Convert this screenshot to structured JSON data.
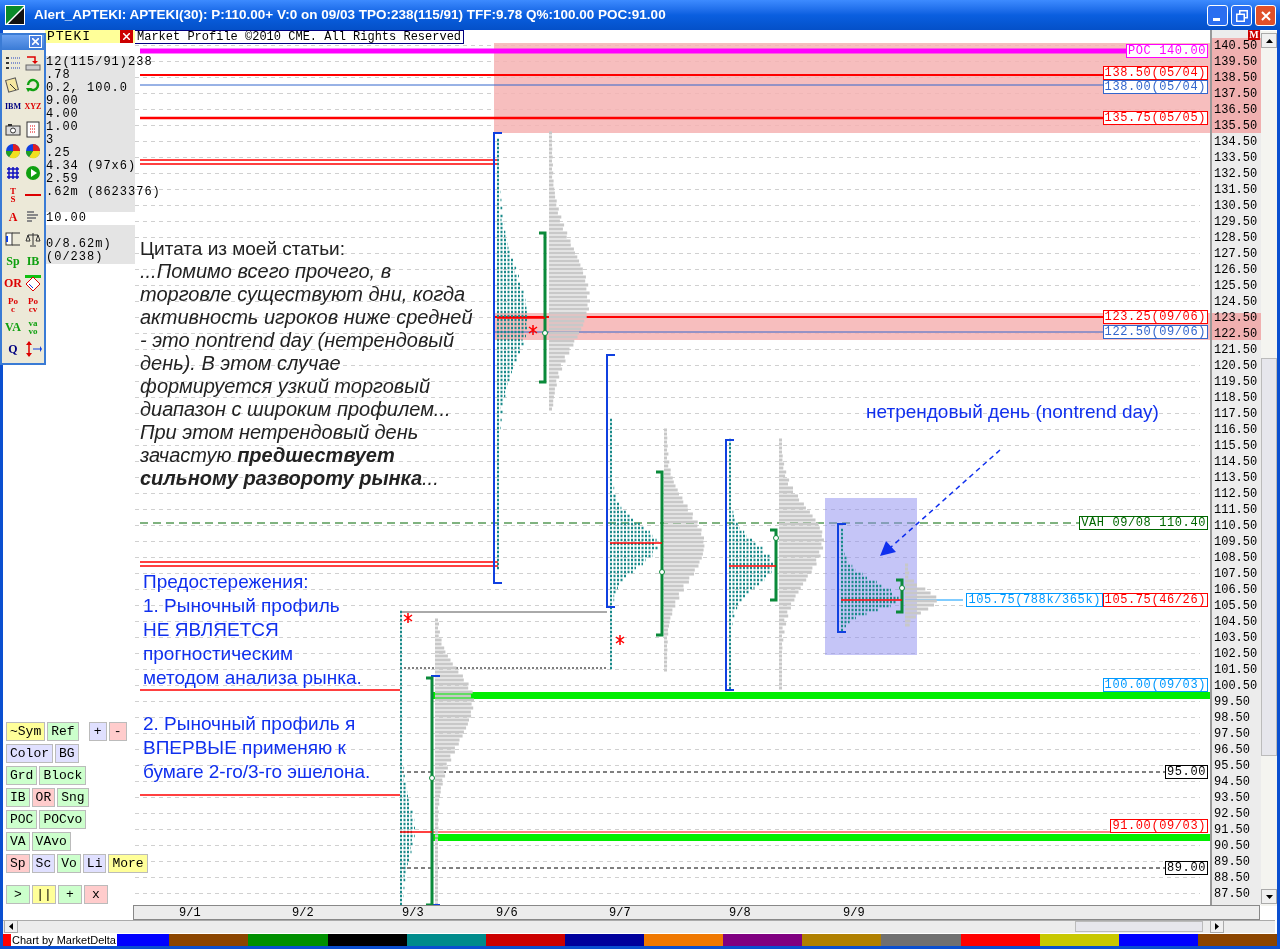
{
  "window": {
    "title": "Alert_APTEKI: APTEKI(30): P:110.00+ V:0 on 09/03 TPO:238(115/91) TFF:9.78 Q%:100.00 POC:91.00"
  },
  "toolbar": {
    "letter_icons": [
      {
        "lines": [
          "IBM"
        ]
      },
      {
        "lines": [
          "XYZ"
        ]
      },
      {
        "lines": [
          "T",
          "S"
        ]
      },
      {
        "lines": [
          "A"
        ]
      },
      {
        "lines": [
          "Sp"
        ]
      },
      {
        "lines": [
          "IB"
        ]
      },
      {
        "lines": [
          "OR"
        ]
      },
      {
        "lines": [
          "Po",
          "c"
        ]
      },
      {
        "lines": [
          "Po",
          "cv"
        ]
      },
      {
        "lines": [
          "VA"
        ]
      },
      {
        "lines": [
          "va",
          "vo"
        ]
      },
      {
        "lines": [
          "Q"
        ]
      }
    ]
  },
  "info_panel": {
    "symbol": "PTEKI",
    "rows": [
      "",
      "12(115/91)238",
      ".78",
      "0.2, 100.0",
      "9.00",
      "4.00",
      "1.00",
      "3",
      ".25",
      "4.34 (97x6)",
      "2.59",
      ".62m (8623376)",
      "",
      "10.00",
      "",
      "0/8.62m)",
      " (0/238)"
    ]
  },
  "chart": {
    "copyright": "Market Profile ©2010 CME. All Rights Reserved",
    "m_button": "M",
    "levels": [
      {
        "text": "POC 140.00",
        "color": "#ff00ff"
      },
      {
        "text": "138.50(05/04)",
        "color": "#ff0000"
      },
      {
        "text": "138.00(05/04)",
        "color": "#3366cc"
      },
      {
        "text": "135.75(05/05)",
        "color": "#ff0000"
      },
      {
        "text": "123.25(09/06)",
        "color": "#ff0000"
      },
      {
        "text": "122.50(09/06)",
        "color": "#3366cc"
      },
      {
        "text": "VAH 09/08 110.40",
        "color": "#006600"
      },
      {
        "text": "105.75(788k/365k)",
        "color": "#0099ff"
      },
      {
        "text": "105.75(46/26)",
        "color": "#ff0000"
      },
      {
        "text": "100.00(09/03)",
        "color": "#0099ff"
      },
      {
        "text": "95.00",
        "color": "#000000"
      },
      {
        "text": "91.00(09/03)",
        "color": "#ff0000"
      },
      {
        "text": "89.00",
        "color": "#000000"
      }
    ],
    "quote_heading": "Цитата из моей статьи:",
    "quote": "...Помимо всего прочего, в торговле существуют дни, когда активность игроков ниже средней - это nontrend day (нетрендовый день). В этом случае формируется узкий торговый диапазон с широким профилем... При этом нетрендовый день зачастую **предшествует сильному развороту рынка**...",
    "nontrend_note": "нетрендовый день (nontrend day)",
    "warnings": [
      "Предостережения:",
      "1. Рыночный профиль НЕ ЯВЛЯЕТСЯ прогностическим методом анализа рынка.",
      "2. Рыночный профиль я ВПЕРВЫЕ применяю к бумаге 2-го/3-го эшелона."
    ],
    "price_axis": [
      "140.50",
      "139.50",
      "138.50",
      "137.50",
      "136.50",
      "135.50",
      "134.50",
      "133.50",
      "132.50",
      "131.50",
      "130.50",
      "129.50",
      "128.50",
      "127.50",
      "126.50",
      "125.50",
      "124.50",
      "123.50",
      "122.50",
      "121.50",
      "120.50",
      "119.50",
      "118.50",
      "117.50",
      "116.50",
      "115.50",
      "114.50",
      "113.50",
      "112.50",
      "111.50",
      "110.50",
      "109.50",
      "108.50",
      "107.50",
      "106.50",
      "105.50",
      "104.50",
      "103.50",
      "102.50",
      "101.50",
      "100.50",
      "99.50",
      "98.50",
      "97.50",
      "96.50",
      "95.50",
      "94.50",
      "93.50",
      "92.50",
      "91.50",
      "90.50",
      "89.50",
      "88.50",
      "87.50"
    ],
    "date_axis": [
      "9/1",
      "9/2",
      "9/3",
      "9/6",
      "9/7",
      "9/8",
      "9/9"
    ]
  },
  "button_rows": [
    {
      "buttons": [
        {
          "label": "~Sym",
          "color": "#ffff99"
        },
        {
          "label": "Ref",
          "color": "#ccffcc"
        },
        {
          "label": "+",
          "color": "#e0e0ff"
        },
        {
          "label": "-",
          "color": "#ffcccc"
        }
      ]
    },
    {
      "buttons": [
        {
          "label": "Color",
          "color": "#e0e0ff"
        },
        {
          "label": "BG",
          "color": "#e0e0ff"
        }
      ]
    },
    {
      "buttons": [
        {
          "label": "Grd",
          "color": "#ccffcc"
        },
        {
          "label": "Block",
          "color": "#ccffcc"
        }
      ]
    },
    {
      "buttons": [
        {
          "label": "IB",
          "color": "#ccffcc"
        },
        {
          "label": "OR",
          "color": "#ffcccc"
        },
        {
          "label": "Sng",
          "color": "#ccffcc"
        }
      ]
    },
    {
      "buttons": [
        {
          "label": "POC",
          "color": "#ccffcc"
        },
        {
          "label": "POCvo",
          "color": "#ccffcc"
        }
      ]
    },
    {
      "buttons": [
        {
          "label": "VA",
          "color": "#ccffcc"
        },
        {
          "label": "VAvo",
          "color": "#ccffcc"
        }
      ]
    },
    {
      "buttons": [
        {
          "label": "Sp",
          "color": "#ffcccc"
        },
        {
          "label": "Sc",
          "color": "#e0e0ff"
        },
        {
          "label": "Vo",
          "color": "#ccffcc"
        },
        {
          "label": "Li",
          "color": "#e0e0ff"
        },
        {
          "label": "More",
          "color": "#ffff99"
        }
      ]
    },
    {
      "buttons": [
        {
          "label": ">",
          "color": "#ccffcc"
        },
        {
          "label": "||",
          "color": "#ffff99"
        },
        {
          "label": "+",
          "color": "#ccffcc"
        },
        {
          "label": "x",
          "color": "#ffcccc"
        }
      ]
    }
  ],
  "status_bar": {
    "credit": "Chart by MarketDelta"
  }
}
